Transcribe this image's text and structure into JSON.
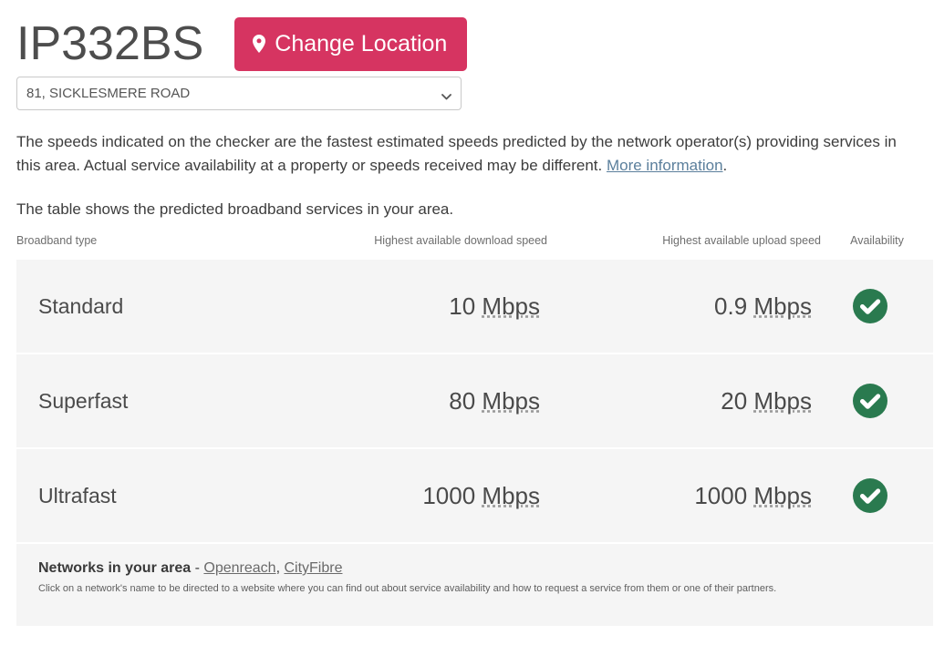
{
  "header": {
    "postcode": "IP332BS",
    "change_location_label": "Change Location",
    "pin_icon": "map-pin-icon",
    "accent_color": "#d63461"
  },
  "address_select": {
    "selected": "81, SICKLESMERE ROAD",
    "chevron_icon": "chevron-down-icon",
    "options": [
      "81, SICKLESMERE ROAD"
    ]
  },
  "intro": {
    "paragraph_1_before_link": "The speeds indicated on the checker are the fastest estimated speeds predicted by the network operator(s) providing services in this area. Actual service availability at a property or speeds received may be different. ",
    "more_information_link": "More information",
    "paragraph_1_after_link": ".",
    "paragraph_2": "The table shows the predicted broadband services in your area."
  },
  "table": {
    "headers": {
      "type": "Broadband type",
      "download": "Highest available download speed",
      "upload": "Highest available upload speed",
      "availability": "Availability"
    },
    "unit": "Mbps",
    "available_icon": "green-check-circle-icon",
    "available_color": "#2a7a4f",
    "rows": [
      {
        "type": "Standard",
        "download_value": "10",
        "download_unit": "Mbps",
        "upload_value": "0.9",
        "upload_unit": "Mbps",
        "availability": "available"
      },
      {
        "type": "Superfast",
        "download_value": "80",
        "download_unit": "Mbps",
        "upload_value": "20",
        "upload_unit": "Mbps",
        "availability": "available"
      },
      {
        "type": "Ultrafast",
        "download_value": "1000",
        "download_unit": "Mbps",
        "upload_value": "1000",
        "upload_unit": "Mbps",
        "availability": "available"
      }
    ]
  },
  "networks": {
    "title_bold": "Networks in your area",
    "title_separator": " - ",
    "links": [
      "Openreach",
      "CityFibre"
    ],
    "link_separator": ", ",
    "note": "Click on a network's name to be directed to a website where you can find out about service availability and how to request a service from them or one of their partners."
  }
}
